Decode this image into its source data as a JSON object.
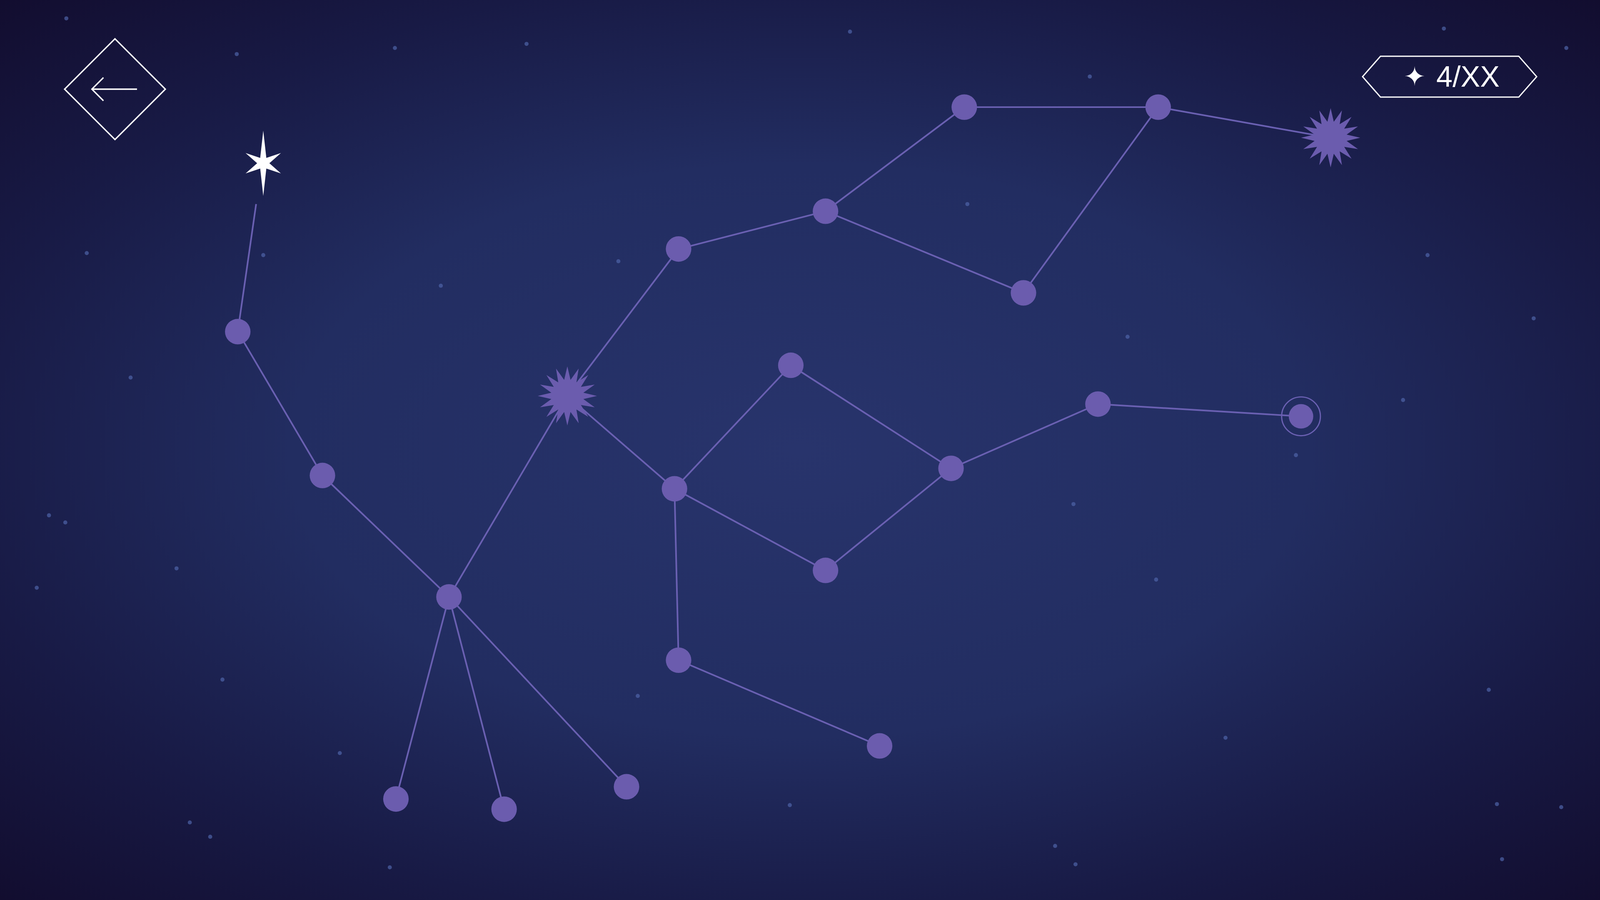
{
  "hud": {
    "progress_icon": "✦",
    "progress": "4/XX"
  },
  "constellation": {
    "nodes": [
      {
        "kind": "visited"
      },
      {
        "kind": "star"
      },
      {
        "kind": "star"
      },
      {
        "kind": "star"
      },
      {
        "kind": "star"
      },
      {
        "kind": "star"
      },
      {
        "kind": "star"
      },
      {
        "kind": "major"
      },
      {
        "kind": "star"
      },
      {
        "kind": "star"
      },
      {
        "kind": "star"
      },
      {
        "kind": "star"
      },
      {
        "kind": "major"
      },
      {
        "kind": "star"
      },
      {
        "kind": "star"
      },
      {
        "kind": "star"
      },
      {
        "kind": "star"
      },
      {
        "kind": "star"
      },
      {
        "kind": "star"
      },
      {
        "kind": "current"
      },
      {
        "kind": "star"
      },
      {
        "kind": "star"
      }
    ]
  }
}
